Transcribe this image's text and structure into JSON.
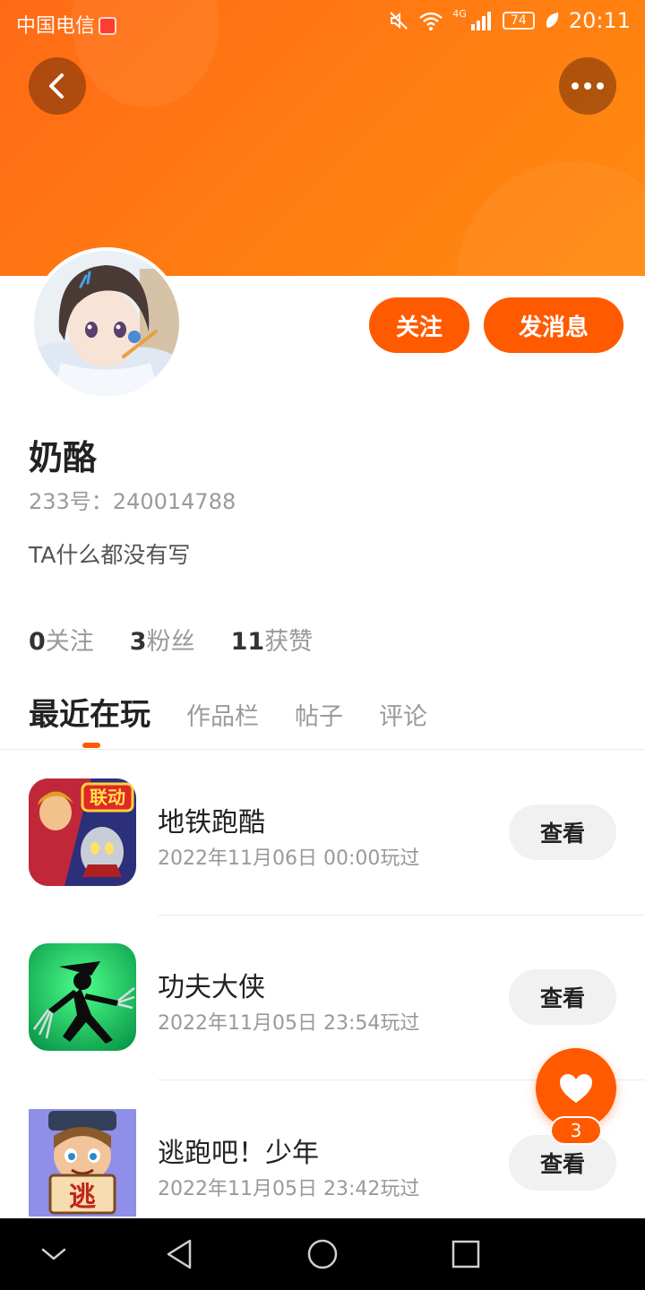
{
  "status_bar": {
    "carrier": "中国电信",
    "network": "4G",
    "battery": "74",
    "time": "20:11"
  },
  "header": {
    "back_icon": "chevron-left-icon",
    "more_icon": "more-dots-icon",
    "background_color": "#ff7a12"
  },
  "profile": {
    "follow_label": "关注",
    "message_label": "发消息",
    "name": "奶酪",
    "id_text": "233号：240014788",
    "bio": "TA什么都没有写",
    "stats": [
      {
        "value": "0",
        "label": "关注"
      },
      {
        "value": "3",
        "label": "粉丝"
      },
      {
        "value": "11",
        "label": "获赞"
      }
    ]
  },
  "tabs": [
    {
      "label": "最近在玩",
      "active": true
    },
    {
      "label": "作品栏",
      "active": false
    },
    {
      "label": "帖子",
      "active": false
    },
    {
      "label": "评论",
      "active": false
    }
  ],
  "games": [
    {
      "name": "地铁跑酷",
      "time": "2022年11月06日 00:00玩过",
      "button": "查看",
      "icon_badge": "联动"
    },
    {
      "name": "功夫大侠",
      "time": "2022年11月05日 23:54玩过",
      "button": "查看"
    },
    {
      "name": "逃跑吧！少年",
      "time": "2022年11月05日 23:42玩过",
      "button": "查看",
      "icon_badge": "逃"
    }
  ],
  "like": {
    "count": "3",
    "icon": "heart-icon"
  },
  "nav": {
    "icons": [
      "collapse-icon",
      "back-triangle-icon",
      "home-circle-icon",
      "recents-square-icon"
    ]
  },
  "colors": {
    "accent": "#ff5a00",
    "button_gray": "#f1f1f1"
  }
}
